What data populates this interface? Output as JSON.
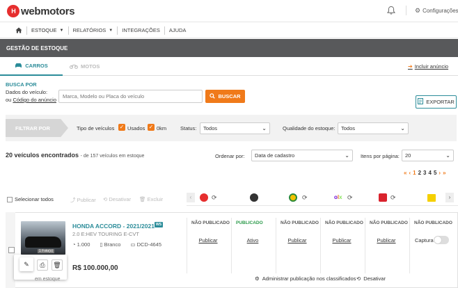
{
  "topbar": {
    "logo_mark": "H",
    "logo_text": "webmotors",
    "config_label": "Configurações"
  },
  "nav": {
    "items": [
      "ESTOQUE",
      "RELATÓRIOS",
      "INTEGRAÇÕES",
      "AJUDA"
    ]
  },
  "section_title": "GESTÃO DE ESTOQUE",
  "tabs": [
    {
      "label": "CARROS",
      "active": true
    },
    {
      "label": "MOTOS",
      "active": false
    }
  ],
  "incluir_anuncio": "Incluir anúncio",
  "busca": {
    "title": "BUSCA POR",
    "line1": "Dados do veículo:",
    "line2_prefix": "ou",
    "line2_link": "Código do anúncio",
    "placeholder": "Marca, Modelo ou Placa do veículo",
    "button": "BUSCAR"
  },
  "exportar": "EXPORTAR",
  "filter": {
    "filtrar_por": "FILTRAR POR",
    "tipo_label": "Tipo de veículos",
    "usados": "Usados",
    "zero_km": "0km",
    "status_label": "Status:",
    "status_value": "Todos",
    "qualidade_label": "Qualidade do estoque:",
    "qualidade_value": "Todos"
  },
  "results": {
    "count": "20 veículos encontrados",
    "sub": "- de 157 veículos em estoque",
    "ordenar_label": "Ordenar por:",
    "ordenar_value": "Data de cadastro",
    "itens_label": "Itens por página:",
    "itens_value": "20"
  },
  "pagination": [
    "«",
    "‹",
    "1",
    "2",
    "3",
    "4",
    "5",
    "›",
    "»"
  ],
  "list_actions": {
    "select_all": "Selecionar todos",
    "publicar": "Publicar",
    "desativar": "Desativar",
    "excluir": "Excluir"
  },
  "vehicle": {
    "title": "HONDA ACCORD - 2021/2021",
    "badge": "WS",
    "version": "2.0 E:HEV TOURING E-CVT",
    "km": "1.000",
    "color": "Branco",
    "plate": "DCD-4645",
    "price": "R$ 100.000,00",
    "photo_tag": "1 Foto(s)",
    "estoque_text": "em estoque"
  },
  "portals": [
    {
      "status": "NÃO PUBLICADO",
      "action": "Publicar",
      "color": "#e62e2e"
    },
    {
      "status": "PUBLICADO",
      "action": "Ativo",
      "color": "#333333"
    },
    {
      "status": "NÃO PUBLICADO",
      "action": "Publicar",
      "color": "#f2c200"
    },
    {
      "status": "NÃO PUBLICADO",
      "action": "Publicar",
      "color": "#6e0ad6"
    },
    {
      "status": "NÃO PUBLICADO",
      "action": "Publicar",
      "color": "#d9232d"
    },
    {
      "status": "NÃO PUBLICADO",
      "action": "Captura",
      "color": "#f5d000"
    }
  ],
  "bottom": {
    "administrar": "Administrar publicação nos classificados",
    "desativar": "Desativar"
  },
  "colors": {
    "accent": "#2b8c99",
    "orange": "#f07a1a",
    "header_gray": "#58595b"
  }
}
